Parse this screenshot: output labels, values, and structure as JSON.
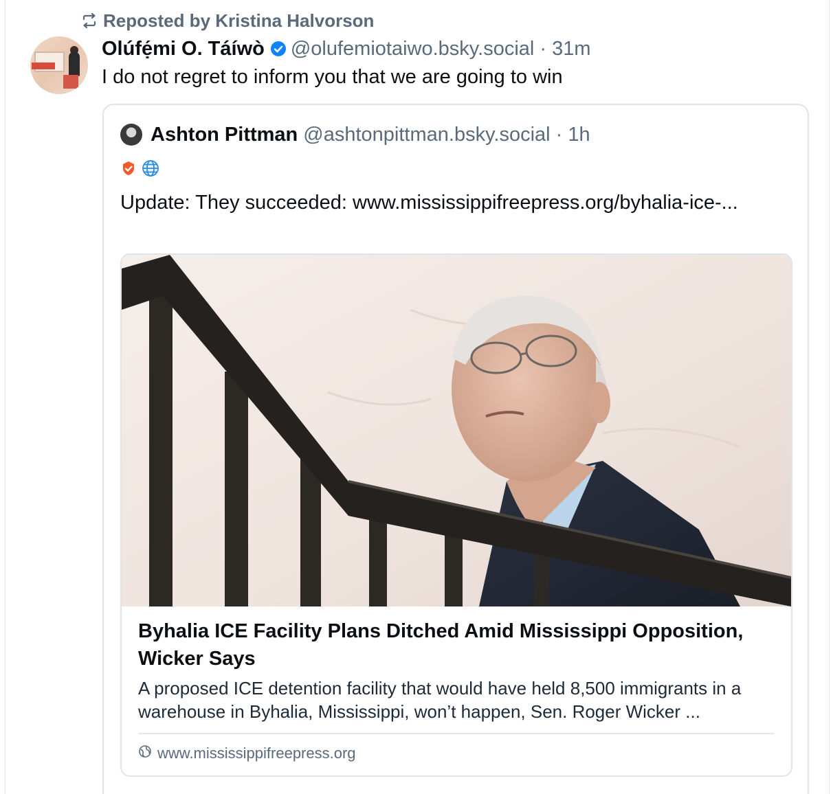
{
  "repost": {
    "label": "Reposted by Kristina Halvorson",
    "icon": "repost-icon"
  },
  "post": {
    "author_name": "Olúfẹ́mi O. Táíwò",
    "verified_icon": "verified-check-icon",
    "handle_time": "@olufemiotaiwo.bsky.social · 31m",
    "text": "I do not regret to inform you that we are going to win"
  },
  "quote": {
    "author_name": "Ashton Pittman",
    "handle_time": "@ashtonpittman.bsky.social · 1h",
    "badges": [
      "check-badge-icon",
      "globe-icon"
    ],
    "text": "Update: They succeeded: www.mississippifreepress.org/byhalia-ice-..."
  },
  "link_card": {
    "image_icon": "article-photo",
    "title": "Byhalia ICE Facility Plans Ditched Amid Mississippi Opposition, Wicker Says",
    "description": "A proposed ICE detention facility that would have held 8,500 immigrants in a warehouse in Byhalia, Mississippi, won’t happen, Sen. Roger Wicker ...",
    "domain": "www.mississippifreepress.org",
    "domain_icon": "globe-icon"
  },
  "colors": {
    "text_primary": "#0b0f14",
    "text_secondary": "#5b6a7b",
    "verified_blue": "#1083fe",
    "border": "#dfe4ea",
    "badge_orange": "#f0592a"
  }
}
